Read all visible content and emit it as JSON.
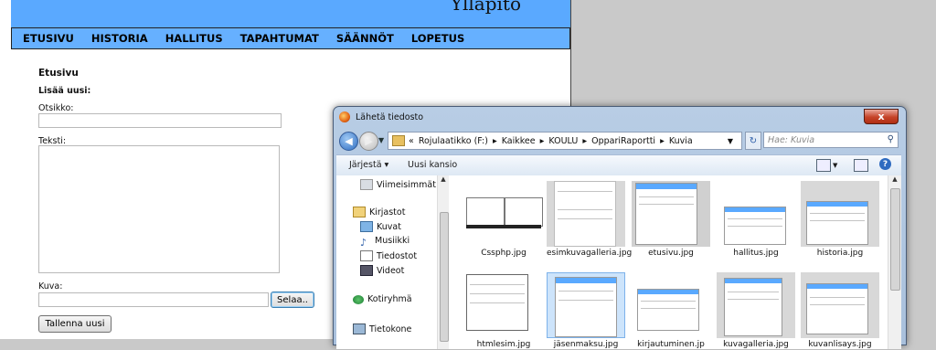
{
  "site": {
    "banner_title": "Ylläpito",
    "nav": [
      "ETUSIVU",
      "HISTORIA",
      "HALLITUS",
      "TAPAHTUMAT",
      "SÄÄNNÖT",
      "LOPETUS"
    ],
    "section_title": "Etusivu",
    "add_new": "Lisää uusi:",
    "title_label": "Otsikko:",
    "text_label": "Teksti:",
    "image_label": "Kuva:",
    "browse_button": "Selaa..",
    "save_button": "Tallenna uusi"
  },
  "dialog": {
    "title": "Lähetä tiedosto",
    "close_symbol": "x",
    "path": [
      "«",
      "Rojulaatikko (F:)",
      "▸",
      "Kaikkee",
      "▸",
      "KOULU",
      "▸",
      "OppariRaportti",
      "▸",
      "Kuvia"
    ],
    "search_placeholder": "Hae: Kuvia",
    "toolbar": {
      "organize": "Järjestä ▾",
      "new_folder": "Uusi kansio"
    },
    "nav_items": [
      {
        "label": "Viimeisimmät sij",
        "icon": "recent-places-icon"
      },
      {
        "label": "Kirjastot",
        "icon": "libraries-icon"
      },
      {
        "label": "Kuvat",
        "icon": "pictures-icon"
      },
      {
        "label": "Musiikki",
        "icon": "music-icon"
      },
      {
        "label": "Tiedostot",
        "icon": "documents-icon"
      },
      {
        "label": "Videot",
        "icon": "videos-icon"
      },
      {
        "label": "Kotiryhmä",
        "icon": "homegroup-icon"
      },
      {
        "label": "Tietokone",
        "icon": "computer-icon"
      }
    ],
    "files": [
      {
        "name": "Cssphp.jpg",
        "selected": false
      },
      {
        "name": "esimkuvagalleria.jpg",
        "selected": false
      },
      {
        "name": "etusivu.jpg",
        "selected": false
      },
      {
        "name": "hallitus.jpg",
        "selected": false
      },
      {
        "name": "historia.jpg",
        "selected": false
      },
      {
        "name": "htmlesim.jpg",
        "selected": false
      },
      {
        "name": "jäsenmaksu.jpg",
        "selected": true
      },
      {
        "name": "kirjautuminen.jp",
        "selected": false
      },
      {
        "name": "kuvagalleria.jpg",
        "selected": false
      },
      {
        "name": "kuvanlisays.jpg",
        "selected": false
      }
    ]
  }
}
